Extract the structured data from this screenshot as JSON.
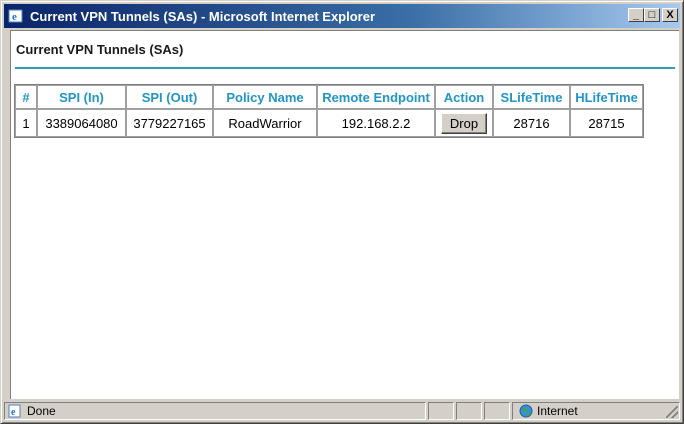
{
  "window": {
    "title": "Current VPN Tunnels (SAs) - Microsoft Internet Explorer",
    "icon": "ie-icon",
    "controls": {
      "minimize": "_",
      "maximize": "□",
      "close": "X"
    }
  },
  "page": {
    "heading": "Current VPN Tunnels (SAs)",
    "accent_color": "#2f9fb0",
    "header_color": "#2196c4"
  },
  "table": {
    "headers": [
      "#",
      "SPI (In)",
      "SPI (Out)",
      "Policy Name",
      "Remote Endpoint",
      "Action",
      "SLifeTime",
      "HLifeTime"
    ],
    "rows": [
      {
        "num": "1",
        "spi_in": "3389064080",
        "spi_out": "3779227165",
        "policy_name": "RoadWarrior",
        "remote_endpoint": "192.168.2.2",
        "action_label": "Drop",
        "slifetime": "28716",
        "hlifetime": "28715"
      }
    ]
  },
  "statusbar": {
    "status_text": "Done",
    "status_icon": "ie-page-icon",
    "zone_text": "Internet",
    "zone_icon": "globe-icon"
  }
}
